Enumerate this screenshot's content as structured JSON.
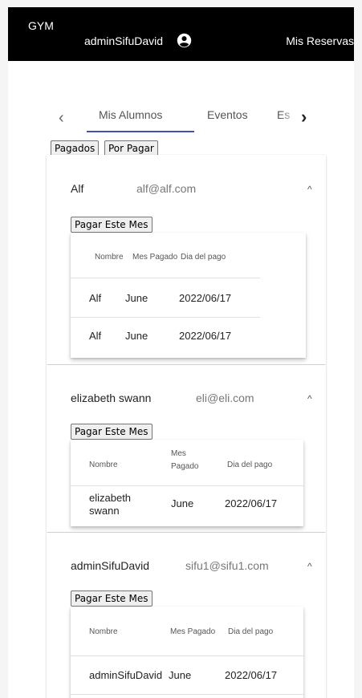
{
  "topbar": {
    "brand": "GYM",
    "username": "adminSifuDavid",
    "user_icon": "account-circle-icon",
    "reservas_link": "Mis Reservas"
  },
  "tabs": {
    "prev_icon": "chevron-left-icon",
    "next_icon": "chevron-right-icon",
    "items": [
      {
        "label": "Mis Alumnos",
        "active": true
      },
      {
        "label": "Eventos",
        "active": false
      },
      {
        "label": "Es",
        "active": false
      }
    ]
  },
  "filters": {
    "pagados": "Pagados",
    "por_pagar": "Por Pagar"
  },
  "panels": [
    {
      "name": "Alf",
      "email": "alf@alf.com",
      "chevron": "^",
      "pay_button": "Pagar Este Mes",
      "headers": {
        "nombre": "Nombre",
        "mes_pagado": "Mes Pagado",
        "dia_pago": "Dia del pago"
      },
      "rows": [
        {
          "nombre": "Alf",
          "mes": "June",
          "dia": "2022/06/17"
        },
        {
          "nombre": "Alf",
          "mes": "June",
          "dia": "2022/06/17"
        }
      ]
    },
    {
      "name": "elizabeth swann",
      "email": "eli@eli.com",
      "chevron": "^",
      "pay_button": "Pagar Este Mes",
      "headers": {
        "nombre": "Nombre",
        "mes_line1": "Mes",
        "mes_line2": "Pagado",
        "dia_pago": "Dia del pago"
      },
      "rows": [
        {
          "nombre_line1": "elizabeth",
          "nombre_line2": "swann",
          "mes": "June",
          "dia": "2022/06/17"
        }
      ]
    },
    {
      "name": "adminSifuDavid",
      "email": "sifu1@sifu1.com",
      "chevron": "^",
      "pay_button": "Pagar Este Mes",
      "headers": {
        "nombre": "Nombre",
        "mes_pagado": "Mes Pagado",
        "dia_pago": "Dia del pago"
      },
      "rows": [
        {
          "nombre": "adminSifuDavid",
          "mes": "June",
          "dia": "2022/06/17"
        }
      ]
    }
  ]
}
